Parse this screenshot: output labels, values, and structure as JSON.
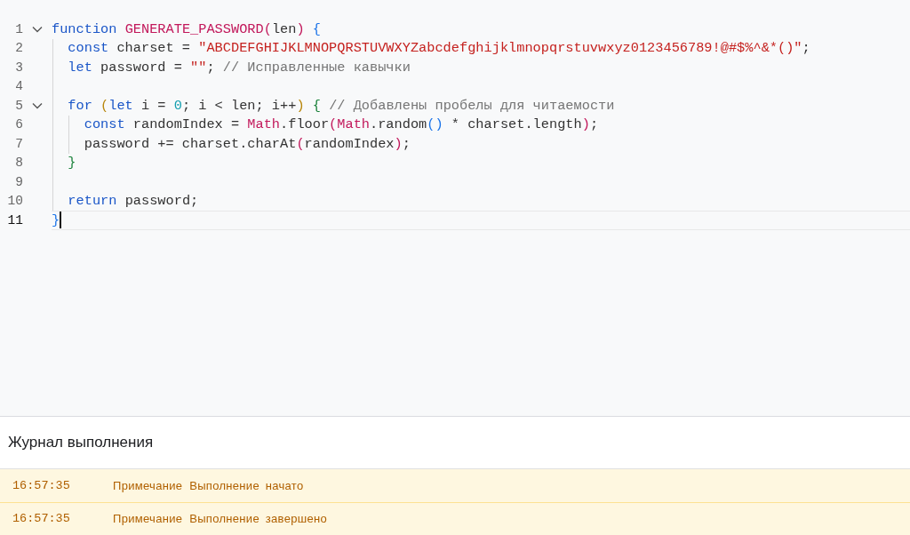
{
  "editor": {
    "lines": [
      {
        "number": "1",
        "foldable": true,
        "current": false,
        "tokens": [
          {
            "text": "function ",
            "kind": "keyword"
          },
          {
            "text": "GENERATE_PASSWORD",
            "kind": "function"
          },
          {
            "text": "(",
            "kind": "bracket1"
          },
          {
            "text": "len",
            "kind": "plain"
          },
          {
            "text": ")",
            "kind": "bracket1"
          },
          {
            "text": " {",
            "kind": "bracket2"
          }
        ]
      },
      {
        "number": "2",
        "foldable": false,
        "current": false,
        "tokens": [
          {
            "text": "  const ",
            "kind": "keyword"
          },
          {
            "text": "charset = ",
            "kind": "plain"
          },
          {
            "text": "\"ABCDEFGHIJKLMNOPQRSTUVWXYZabcdefghijklmnopqrstuvwxyz0123456789!@#$%^&*()\"",
            "kind": "string"
          },
          {
            "text": ";",
            "kind": "plain"
          }
        ]
      },
      {
        "number": "3",
        "foldable": false,
        "current": false,
        "tokens": [
          {
            "text": "  let ",
            "kind": "keyword"
          },
          {
            "text": "password = ",
            "kind": "plain"
          },
          {
            "text": "\"\"",
            "kind": "string"
          },
          {
            "text": "; ",
            "kind": "plain"
          },
          {
            "text": "// Исправленные кавычки",
            "kind": "comment"
          }
        ]
      },
      {
        "number": "4",
        "foldable": false,
        "current": false
      },
      {
        "number": "5",
        "foldable": true,
        "current": false,
        "tokens": [
          {
            "text": "  for ",
            "kind": "keyword"
          },
          {
            "text": "(",
            "kind": "bracket3"
          },
          {
            "text": "let ",
            "kind": "keyword"
          },
          {
            "text": "i = ",
            "kind": "plain"
          },
          {
            "text": "0",
            "kind": "number"
          },
          {
            "text": "; i < len; i++",
            "kind": "plain"
          },
          {
            "text": ")",
            "kind": "bracket3"
          },
          {
            "text": " {",
            "kind": "bracket4"
          },
          {
            "text": " // Добавлены пробелы для читаемости",
            "kind": "comment"
          }
        ]
      },
      {
        "number": "6",
        "foldable": false,
        "current": false,
        "tokens": [
          {
            "text": "    const ",
            "kind": "keyword"
          },
          {
            "text": "randomIndex = ",
            "kind": "plain"
          },
          {
            "text": "Math",
            "kind": "function"
          },
          {
            "text": ".floor",
            "kind": "plain"
          },
          {
            "text": "(",
            "kind": "bracket1"
          },
          {
            "text": "Math",
            "kind": "function"
          },
          {
            "text": ".random",
            "kind": "plain"
          },
          {
            "text": "()",
            "kind": "bracket2"
          },
          {
            "text": " * charset.length",
            "kind": "plain"
          },
          {
            "text": ")",
            "kind": "bracket1"
          },
          {
            "text": ";",
            "kind": "plain"
          }
        ]
      },
      {
        "number": "7",
        "foldable": false,
        "current": false,
        "tokens": [
          {
            "text": "    password += charset.charAt",
            "kind": "plain"
          },
          {
            "text": "(",
            "kind": "bracket1"
          },
          {
            "text": "randomIndex",
            "kind": "plain"
          },
          {
            "text": ")",
            "kind": "bracket1"
          },
          {
            "text": ";",
            "kind": "plain"
          }
        ]
      },
      {
        "number": "8",
        "foldable": false,
        "current": false,
        "tokens": [
          {
            "text": "  }",
            "kind": "bracket4"
          }
        ]
      },
      {
        "number": "9",
        "foldable": false,
        "current": false
      },
      {
        "number": "10",
        "foldable": false,
        "current": false,
        "tokens": [
          {
            "text": "  return ",
            "kind": "keyword"
          },
          {
            "text": "password;",
            "kind": "plain"
          }
        ]
      },
      {
        "number": "11",
        "foldable": false,
        "current": true,
        "tokens": [
          {
            "text": "}",
            "kind": "bracket2"
          }
        ]
      }
    ]
  },
  "log": {
    "title": "Журнал выполнения",
    "rows": [
      {
        "time": "16:57:35",
        "type": "Примечание",
        "message": "Выполнение начато"
      },
      {
        "time": "16:57:35",
        "type": "Примечание",
        "message": "Выполнение завершено"
      }
    ]
  }
}
